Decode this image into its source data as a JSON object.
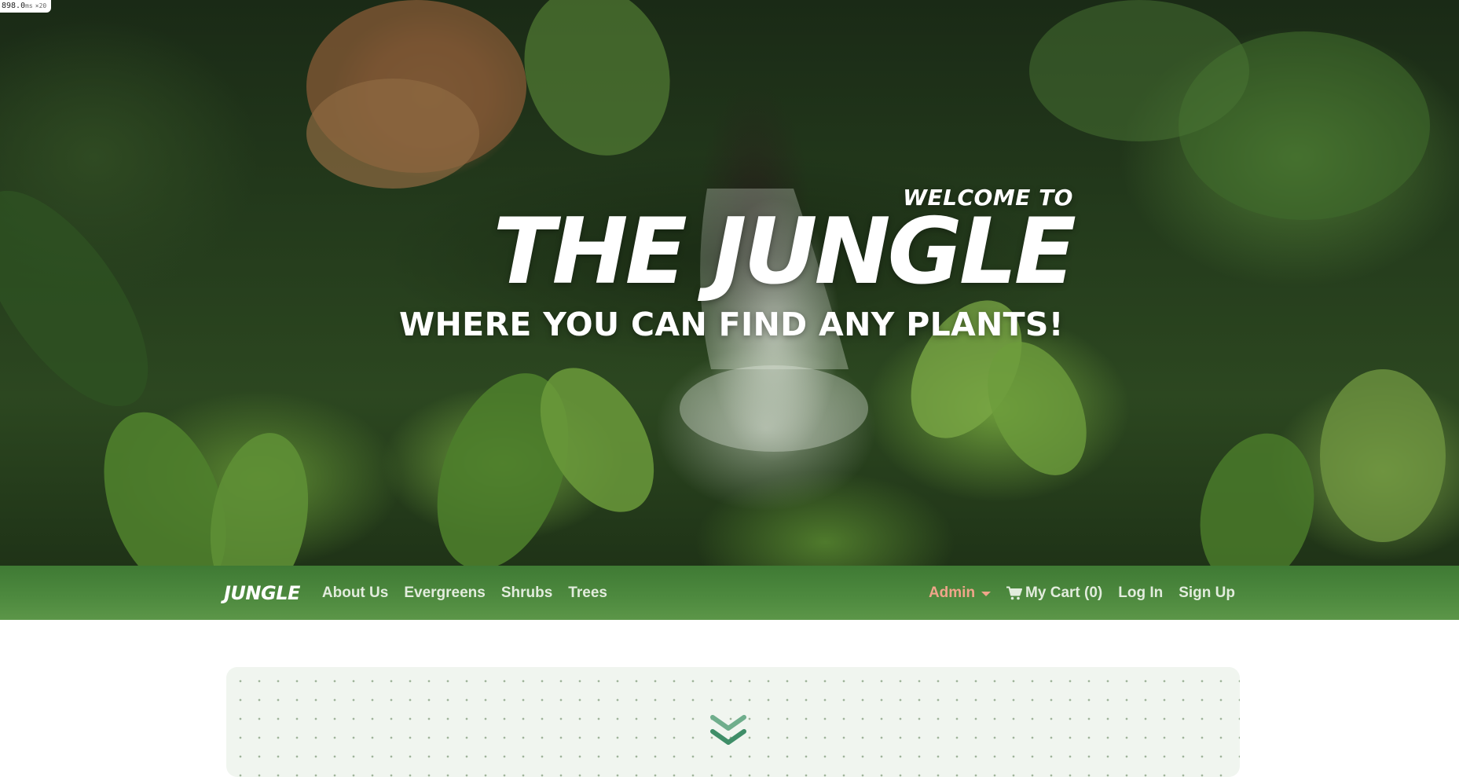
{
  "perf": {
    "value": "898.0",
    "unit": "ms",
    "multiplier": "×20"
  },
  "hero": {
    "welcome": "WELCOME TO",
    "title": "THE JUNGLE",
    "tagline": "WHERE YOU CAN FIND ANY PLANTS!"
  },
  "navbar": {
    "brand": "JUNGLE",
    "links": [
      "About Us",
      "Evergreens",
      "Shrubs",
      "Trees"
    ],
    "admin_label": "Admin",
    "cart_label": "My Cart (0)",
    "login_label": "Log In",
    "signup_label": "Sign Up",
    "cart_icon": "shopping-cart-icon",
    "admin_icon": "caret-down-icon"
  },
  "content": {
    "scroll_icon": "double-chevron-down-icon"
  },
  "colors": {
    "navbar_green": "#4e8a3f",
    "admin_accent": "#f0a58a",
    "chevron_green": "#3f8e68",
    "panel_bg": "#f0f5ef"
  }
}
